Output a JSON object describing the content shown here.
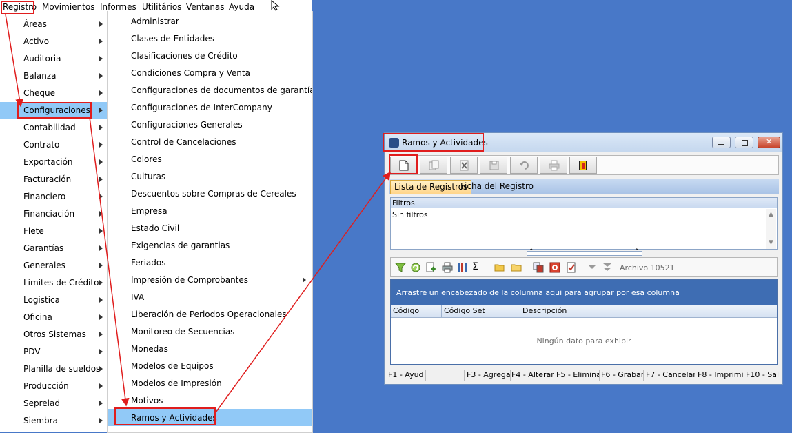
{
  "menubar": {
    "items": [
      "Registro",
      "Movimientos",
      "Informes",
      "Utilitários",
      "Ventanas",
      "Ayuda"
    ]
  },
  "menu_registro": {
    "items": [
      "Áreas",
      "Activo",
      "Auditoria",
      "Balanza",
      "Cheque",
      "Configuraciones",
      "Contabilidad",
      "Contrato",
      "Exportación",
      "Facturación",
      "Financiero",
      "Financiación",
      "Flete",
      "Garantías",
      "Generales",
      "Limites de Crédito",
      "Logistica",
      "Oficina",
      "Otros Sistemas",
      "PDV",
      "Planilla de sueldos",
      "Producción",
      "Seprelad",
      "Siembra"
    ],
    "selected": "Configuraciones"
  },
  "menu_configuraciones": {
    "items": [
      "Administrar",
      "Clases de Entidades",
      "Clasificaciones de Crédito",
      "Condiciones Compra y Venta",
      "Configuraciones de documentos de garantía",
      "Configuraciones de InterCompany",
      "Configuraciones Generales",
      "Control de Cancelaciones",
      "Colores",
      "Culturas",
      "Descuentos sobre Compras de Cereales",
      "Empresa",
      "Estado Civil",
      "Exigencias de garantias",
      "Feriados",
      "Impresión de Comprobantes",
      "IVA",
      "Liberación de Periodos Operacionales",
      "Monitoreo de Secuencias",
      "Monedas",
      "Modelos de Equipos",
      "Modelos de Impresión",
      "Motivos",
      "Ramos y Actividades"
    ],
    "submenu_item": "Impresión de Comprobantes",
    "selected": "Ramos y Actividades"
  },
  "window": {
    "title": "Ramos y Actividades",
    "tabs": [
      "Lista de Registros",
      "Ficha del Registro"
    ],
    "filters_header": "Filtros",
    "filters_text": "Sin filtros",
    "archivo_label": "Archivo 10521",
    "group_panel_text": "Arrastre un encabezado de la columna aqui para agrupar por esa columna",
    "columns": [
      "Código",
      "Código Set",
      "Descripción"
    ],
    "empty_text": "Ningún dato para exhibir",
    "function_keys": [
      "F1 - Ayud",
      "",
      "F3 - Agrega",
      "F4 - Alterar",
      "F5 - Elimina",
      "F6 - Grabar",
      "F7 - Cancelar",
      "F8 - Imprimi",
      "F10 - Sali"
    ]
  },
  "colors": {
    "desktop": "#4878c8",
    "selection": "#91c9f7",
    "highlight": "#e01d1d",
    "grid_group_panel": "#3e6db3"
  },
  "icons": {
    "toolbar": [
      "new-doc-icon",
      "copy-doc-icon",
      "delete-icon",
      "save-icon",
      "undo-icon",
      "print-icon",
      "exit-icon"
    ],
    "gridbar": [
      "filter-icon",
      "refresh-icon",
      "export-icon",
      "print-icon",
      "columns-icon",
      "sum-icon",
      "open-folder-icon",
      "folder-icon",
      "copy-icon",
      "stop-icon",
      "checklist-icon",
      "collapse-icon",
      "expand-all-icon"
    ]
  }
}
